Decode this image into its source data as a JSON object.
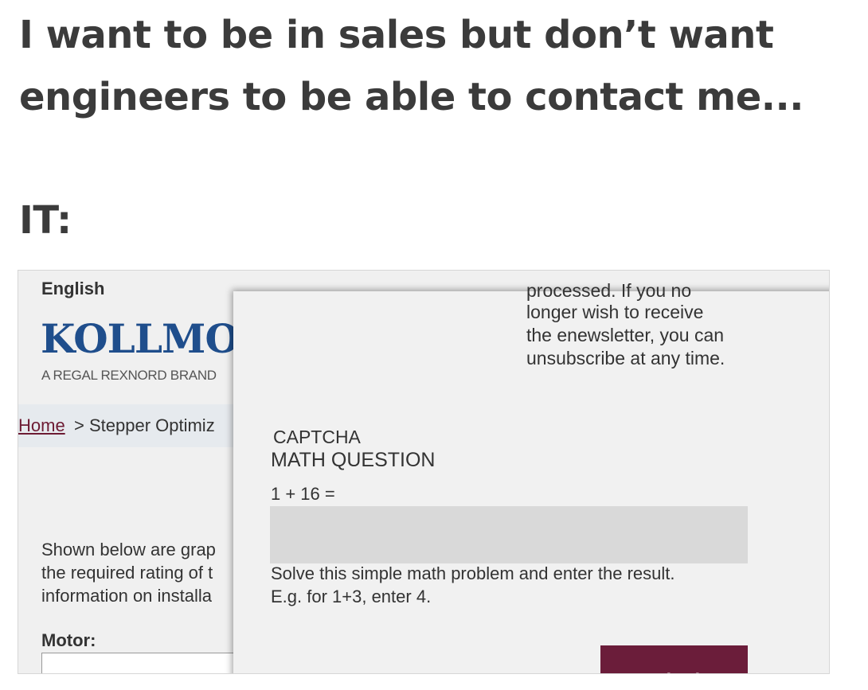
{
  "caption": "I want to be in sales but don’t want engineers to be able to contact me...",
  "it_label": "IT:",
  "site": {
    "language": "English",
    "logo_text": "KOLLMO",
    "tagline": "A REGAL REXNORD BRAND",
    "breadcrumb": {
      "home": "Home",
      "rest": "> Stepper Optimiz"
    },
    "body_lines": [
      "Shown below are grap",
      "the required rating of t",
      "information on installa"
    ],
    "motor_label": "Motor:"
  },
  "modal": {
    "notice_lines": [
      "processed. If you no",
      "longer wish to receive",
      "the enewsletter, you can",
      "unsubscribe at any time."
    ],
    "captcha_title": "CAPTCHA",
    "math_heading": "MATH QUESTION",
    "math_question": "1 + 16 =",
    "answer_value": "",
    "help_lines": [
      "Solve this simple math problem and enter the result.",
      "E.g. for 1+3, enter 4."
    ],
    "submit_label": "Submit"
  },
  "colors": {
    "brand_blue": "#1f4e8c",
    "submit_bg": "#6b1d3a",
    "link_color": "#6d1b33"
  }
}
